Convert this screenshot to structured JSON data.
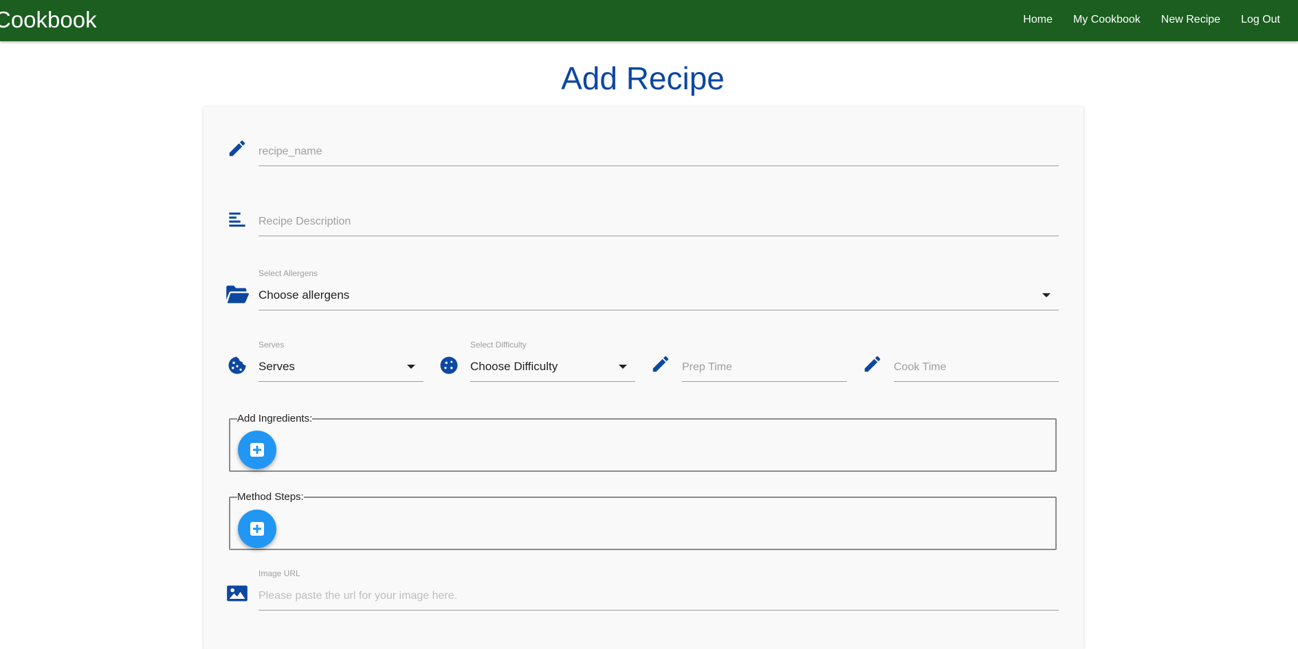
{
  "navbar": {
    "brand": "Cookbook",
    "links": [
      "Home",
      "My Cookbook",
      "New Recipe",
      "Log Out"
    ]
  },
  "page": {
    "title": "Add Recipe"
  },
  "form": {
    "recipe_name": {
      "placeholder": "recipe_name",
      "icon": "pencil-icon"
    },
    "description": {
      "placeholder": "Recipe Description",
      "icon": "notes-icon"
    },
    "allergens": {
      "label": "Select Allergens",
      "selected": "Choose allergens",
      "icon": "folder-open-icon"
    },
    "serves": {
      "label": "Serves",
      "selected": "Serves",
      "icon": "cookie-icon"
    },
    "difficulty": {
      "label": "Select Difficulty",
      "selected": "Choose Difficulty",
      "icon": "cookie-icon"
    },
    "prep_time": {
      "placeholder": "Prep Time",
      "icon": "pencil-icon"
    },
    "cook_time": {
      "placeholder": "Cook Time",
      "icon": "pencil-icon"
    },
    "ingredients": {
      "legend": "Add Ingredients:",
      "add_icon": "plus-square-icon"
    },
    "method": {
      "legend": "Method Steps:",
      "add_icon": "plus-square-icon"
    },
    "image_url": {
      "label": "Image URL",
      "placeholder": "Please paste the url for your image here.",
      "icon": "image-icon"
    }
  },
  "colors": {
    "navbar": "#1b5e20",
    "accent": "#0d47a1",
    "fab": "#2196f3"
  }
}
